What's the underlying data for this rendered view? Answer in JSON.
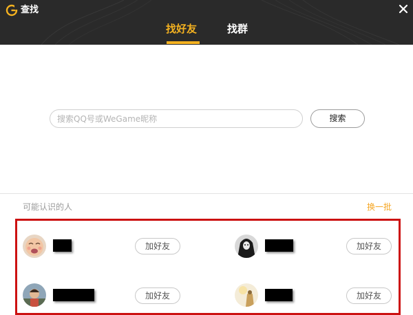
{
  "window": {
    "title": "查找",
    "logo_icon": "wegame-g-logo-icon",
    "close_icon": "close-icon"
  },
  "tabs": [
    {
      "label": "找好友",
      "active": true
    },
    {
      "label": "找群",
      "active": false
    }
  ],
  "search": {
    "placeholder": "搜索QQ号或WeGame昵称",
    "value": "",
    "button_label": "搜索"
  },
  "suggestions": {
    "title": "可能认识的人",
    "refresh_label": "换一批",
    "people": [
      {
        "name": "",
        "avatar": "crying-baby-avatar",
        "add_label": "加好友"
      },
      {
        "name": "",
        "avatar": "dark-hooded-figure-avatar",
        "add_label": "加好友"
      },
      {
        "name": "",
        "avatar": "person-photo-avatar",
        "add_label": "加好友"
      },
      {
        "name": "",
        "avatar": "light-figure-avatar",
        "add_label": "加好友"
      }
    ]
  },
  "colors": {
    "titlebar": "#2a2a2a",
    "accent": "#f5b220",
    "link": "#f5a623",
    "highlight_border": "#cc1111"
  }
}
